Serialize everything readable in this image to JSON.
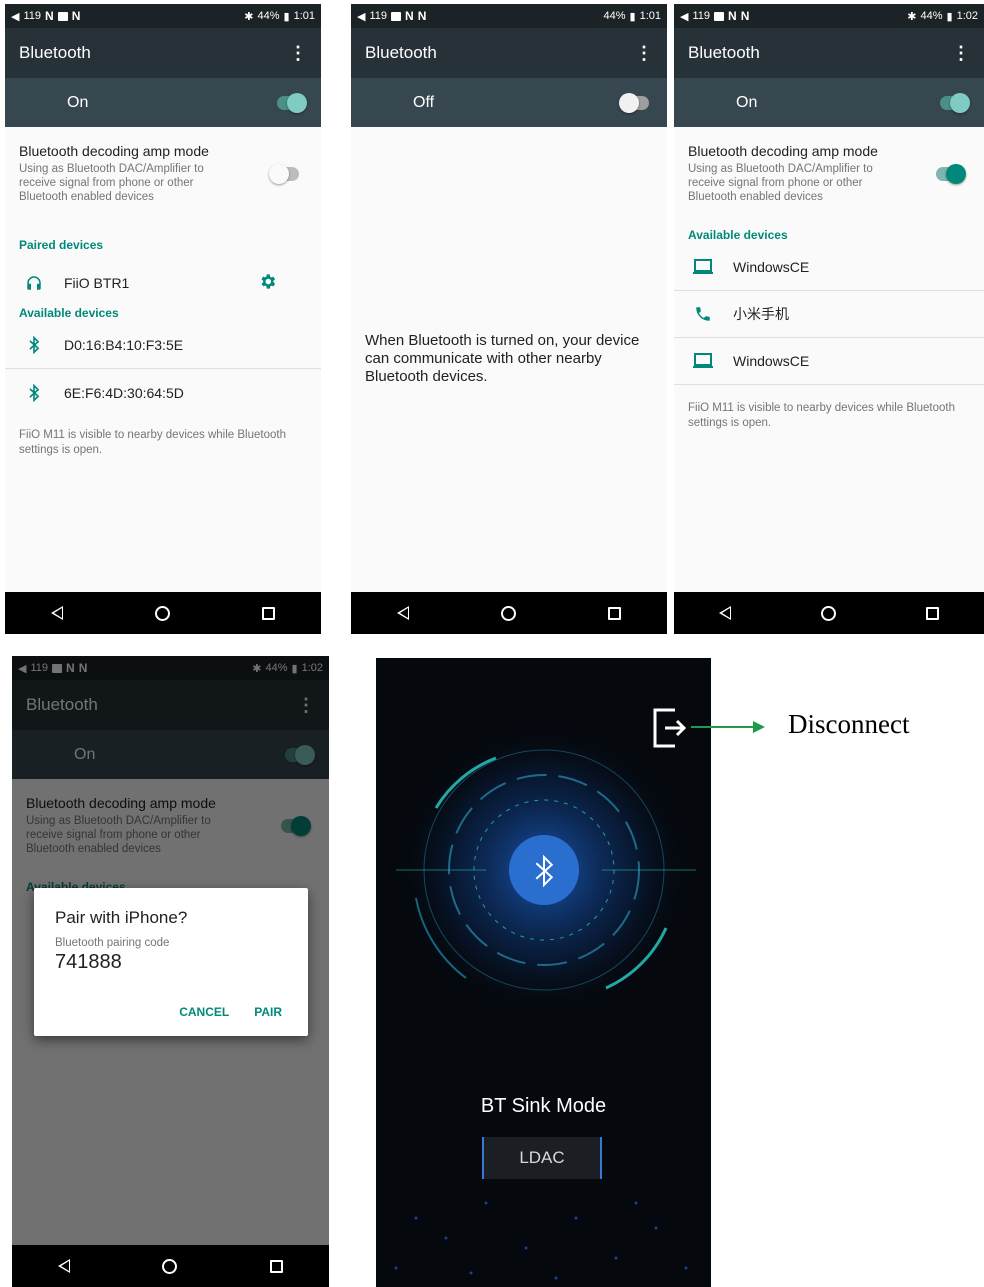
{
  "status": {
    "volume": "119",
    "battery": "44%",
    "time_a": "1:01",
    "time_b": "1:02"
  },
  "title": "Bluetooth",
  "states": {
    "on": "On",
    "off": "Off"
  },
  "amp": {
    "title": "Bluetooth decoding amp mode",
    "desc": "Using as Bluetooth DAC/Amplifier to receive signal from phone or other Bluetooth enabled devices"
  },
  "sections": {
    "paired": "Paired devices",
    "available": "Available devices"
  },
  "screen1": {
    "paired": [
      {
        "name": "FiiO BTR1",
        "icon": "headphones-icon"
      }
    ],
    "available": [
      {
        "name": "D0:16:B4:10:F3:5E",
        "icon": "bluetooth-icon"
      },
      {
        "name": "6E:F6:4D:30:64:5D",
        "icon": "bluetooth-icon"
      }
    ]
  },
  "visible_note": "FiiO M11 is visible to nearby devices while Bluetooth settings is open.",
  "off_message": "When Bluetooth is turned on, your device can communicate with other nearby Bluetooth devices.",
  "screen3": {
    "available": [
      {
        "name": "WindowsCE",
        "icon": "laptop-icon"
      },
      {
        "name": "小米手机",
        "icon": "phone-icon"
      },
      {
        "name": "WindowsCE",
        "icon": "laptop-icon"
      }
    ]
  },
  "dialog": {
    "title": "Pair with iPhone?",
    "label": "Bluetooth pairing code",
    "code": "741888",
    "cancel": "CANCEL",
    "pair": "PAIR"
  },
  "sink": {
    "mode": "BT Sink Mode",
    "codec": "LDAC",
    "callout": "Disconnect"
  }
}
